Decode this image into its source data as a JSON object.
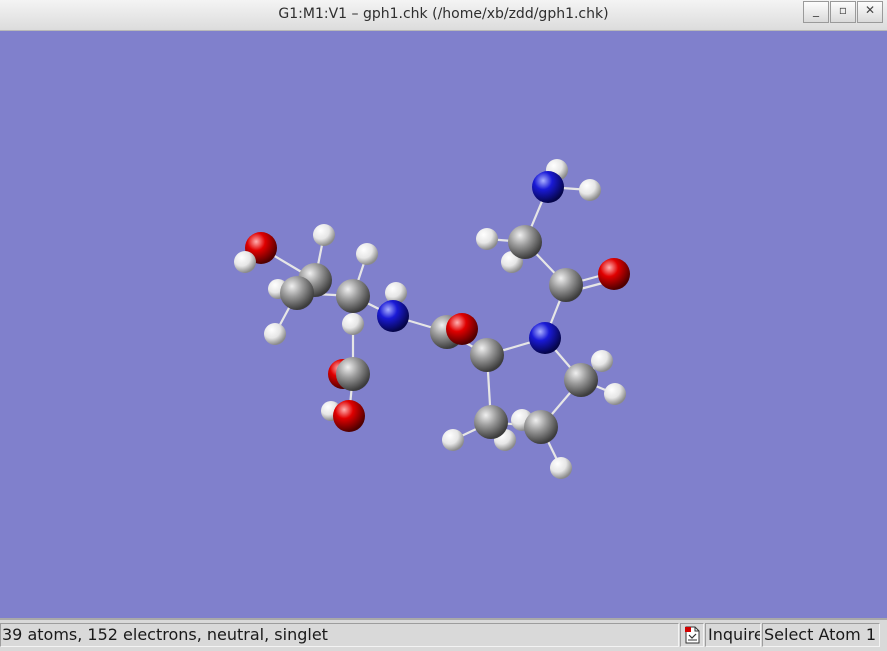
{
  "window": {
    "title": "G1:M1:V1 – gph1.chk (/home/xb/zdd/gph1.chk)",
    "buttons": {
      "minimize_icon": "minimize-icon",
      "maximize_icon": "maximize-icon",
      "close_icon": "close-icon"
    }
  },
  "viewport": {
    "background": "#8080cc",
    "atom_colors": {
      "C": "#8a8a8a",
      "H": "#f0f0f0",
      "N": "#1a1ad6",
      "O": "#e00000"
    }
  },
  "status": {
    "info": "39 atoms, 152 electrons, neutral, singlet",
    "icon": "document-icon",
    "mode": "Inquire",
    "action": "Select Atom 1"
  }
}
